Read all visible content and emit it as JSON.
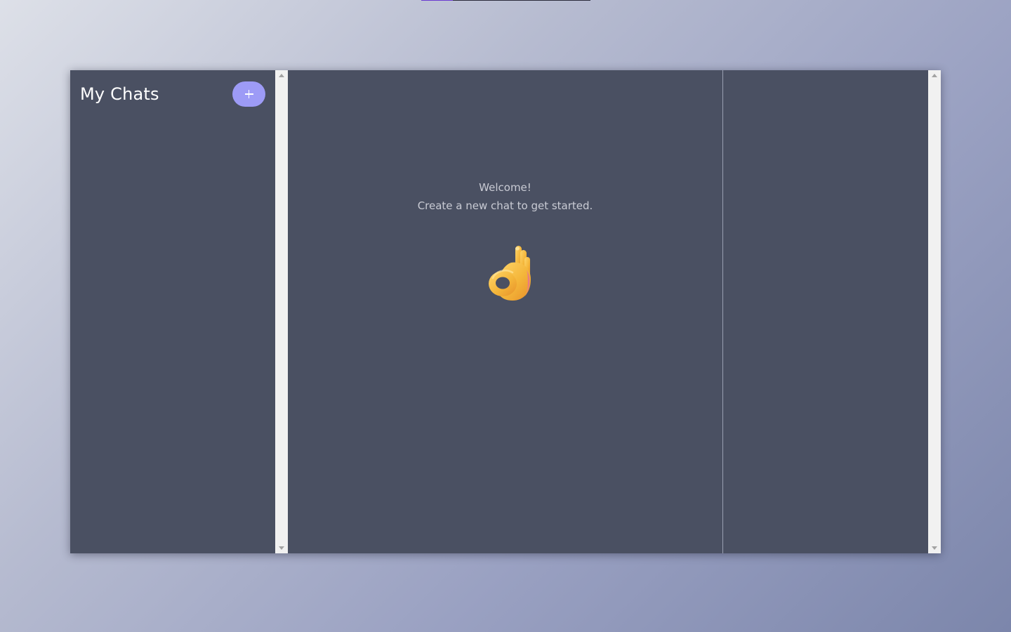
{
  "sidebar": {
    "title": "My Chats",
    "new_chat_icon": "plus-icon"
  },
  "main": {
    "welcome_line1": "Welcome!",
    "welcome_line2": "Create a new chat to get started.",
    "illustration_icon": "ok-hand-icon"
  },
  "colors": {
    "panel_background": "#4a5062",
    "accent": "#9d9bf6",
    "page_gradient_start": "#dde0e8",
    "page_gradient_end": "#7c86ab"
  }
}
